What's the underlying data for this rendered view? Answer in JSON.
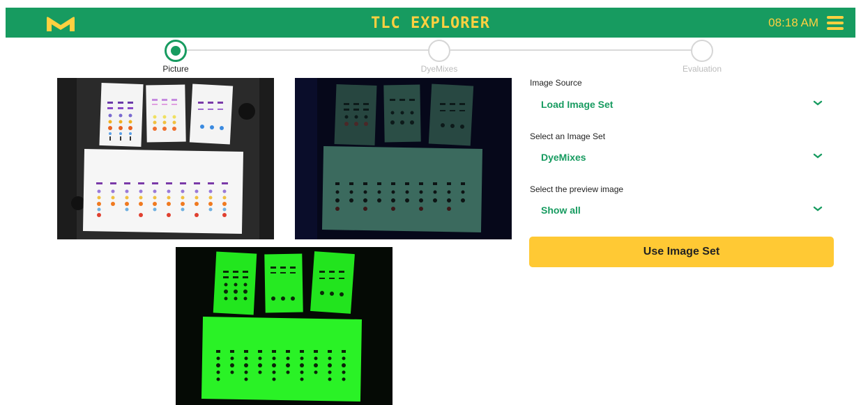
{
  "header": {
    "logo_icon": "merck-m-logo-icon",
    "title": "TLC EXPLORER",
    "time": "08:18 AM",
    "menu_icon": "hamburger-menu-icon",
    "bar_color": "#179b60",
    "accent_color": "#ffd040"
  },
  "stepper": {
    "steps": [
      {
        "label": "Picture",
        "state": "active"
      },
      {
        "label": "DyeMixes",
        "state": "inactive"
      },
      {
        "label": "Evaluation",
        "state": "inactive"
      }
    ]
  },
  "images": [
    {
      "name": "white-light-image",
      "lighting": "white"
    },
    {
      "name": "uv-dark-image",
      "lighting": "uv-366"
    },
    {
      "name": "uv-green-image",
      "lighting": "uv-254"
    }
  ],
  "form": {
    "image_source": {
      "label": "Image Source",
      "value": "Load Image Set"
    },
    "image_set": {
      "label": "Select an Image Set",
      "value": "DyeMixes"
    },
    "preview": {
      "label": "Select the preview image",
      "value": "Show all"
    },
    "chevron_icon": "chevron-down-icon",
    "submit_label": "Use Image Set",
    "button_color": "#ffc934"
  }
}
